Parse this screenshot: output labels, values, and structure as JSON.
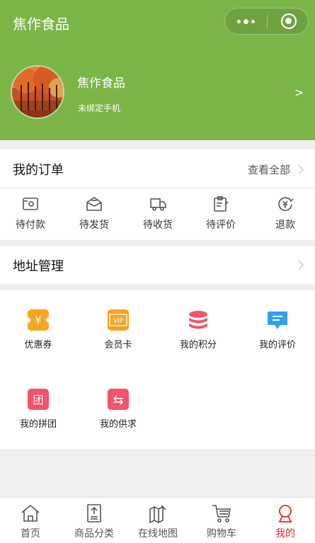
{
  "header": {
    "title": "焦作食品"
  },
  "profile": {
    "name": "焦作食品",
    "phone_status": "未绑定手机",
    "arrow": ">"
  },
  "orders": {
    "title": "我的订单",
    "view_all": "查看全部",
    "items": [
      {
        "label": "待付款",
        "icon": "wallet-icon"
      },
      {
        "label": "待发货",
        "icon": "box-icon"
      },
      {
        "label": "待收货",
        "icon": "truck-icon"
      },
      {
        "label": "待评价",
        "icon": "clipboard-icon"
      },
      {
        "label": "退款",
        "icon": "refund-icon"
      }
    ]
  },
  "address": {
    "title": "地址管理"
  },
  "tools": [
    {
      "label": "优惠券",
      "icon": "coupon-icon",
      "color": "#f5a623",
      "glyph": "¥"
    },
    {
      "label": "会员卡",
      "icon": "vip-card-icon",
      "color": "#f5a623",
      "glyph": "VIP"
    },
    {
      "label": "我的积分",
      "icon": "points-icon",
      "color": "#f2546b",
      "glyph": ""
    },
    {
      "label": "我的评价",
      "icon": "comment-icon",
      "color": "#2ea3f2",
      "glyph": ""
    },
    {
      "label": "我的拼团",
      "icon": "group-buy-icon",
      "color": "#f2546b",
      "glyph": "团"
    },
    {
      "label": "我的供求",
      "icon": "supply-demand-icon",
      "color": "#f2546b",
      "glyph": "⇆"
    }
  ],
  "tabbar": [
    {
      "label": "首页",
      "icon": "home-icon"
    },
    {
      "label": "商品分类",
      "icon": "category-icon"
    },
    {
      "label": "在线地图",
      "icon": "map-icon"
    },
    {
      "label": "购物车",
      "icon": "cart-icon"
    },
    {
      "label": "我的",
      "icon": "user-icon",
      "active": true
    }
  ],
  "colors": {
    "brand_green": "#7bb548",
    "active_red": "#e0262b"
  }
}
